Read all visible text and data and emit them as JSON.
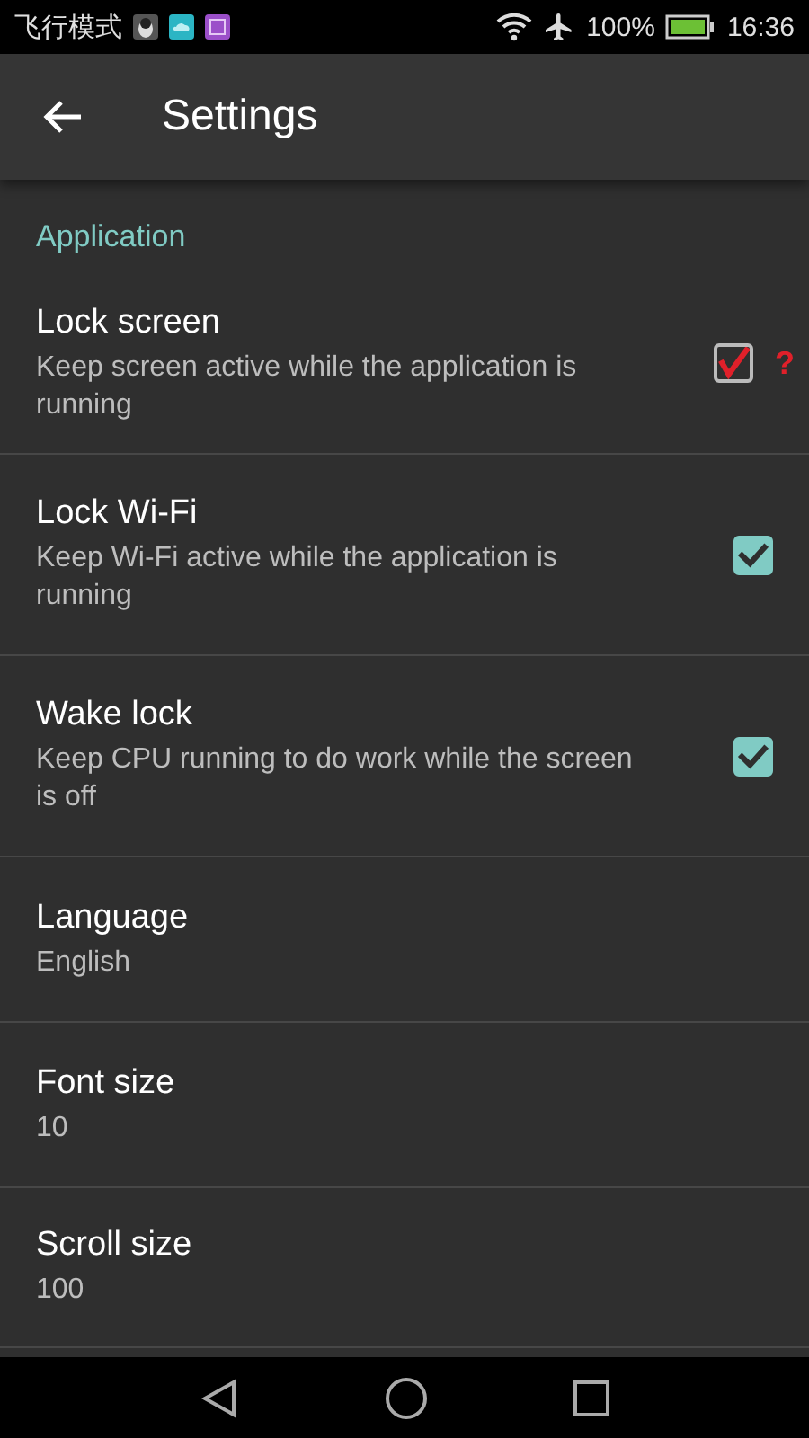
{
  "status_bar": {
    "carrier": "飞行模式",
    "battery": "100%",
    "time": "16:36"
  },
  "app_bar": {
    "title": "Settings"
  },
  "section": {
    "title": "Application"
  },
  "items": [
    {
      "kind": "checkbox",
      "title": "Lock screen",
      "summary": "Keep screen active while the application is running",
      "checked": true,
      "color": "#e0202a",
      "note": "?"
    },
    {
      "kind": "checkbox",
      "title": "Lock Wi-Fi",
      "summary": "Keep Wi-Fi active while the application is running",
      "checked": true,
      "color": "#80cbc4"
    },
    {
      "kind": "checkbox",
      "title": "Wake lock",
      "summary": "Keep CPU running to do work while the screen is off",
      "checked": true,
      "color": "#80cbc4"
    },
    {
      "kind": "value",
      "title": "Language",
      "summary": "English"
    },
    {
      "kind": "value",
      "title": "Font size",
      "summary": "10"
    },
    {
      "kind": "value",
      "title": "Scroll size",
      "summary": "100"
    }
  ]
}
